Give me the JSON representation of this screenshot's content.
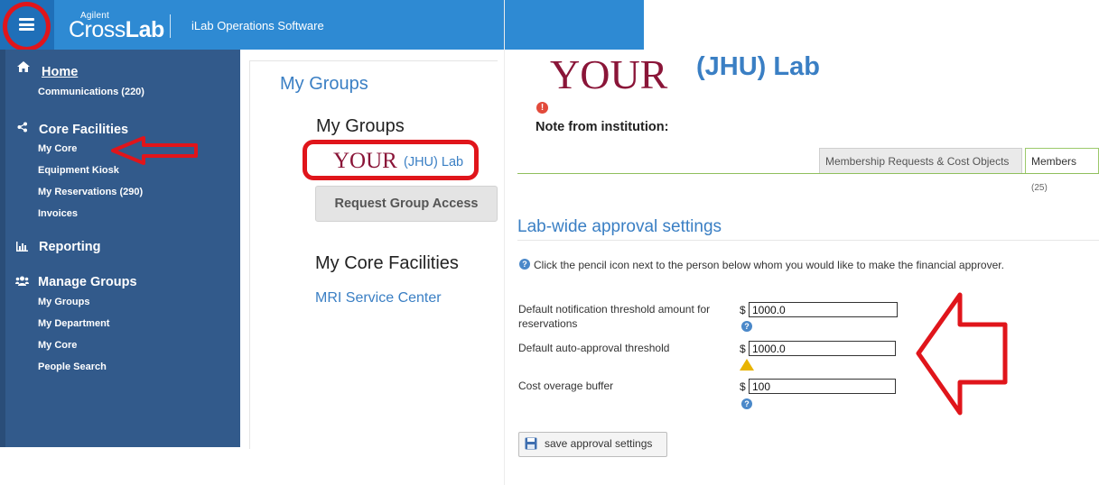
{
  "header": {
    "brand_small": "Agilent",
    "brand_light": "Cross",
    "brand_bold": "Lab",
    "app_name": "iLab Operations Software",
    "menu_icon": "hamburger-icon"
  },
  "sidebar": {
    "sections": [
      {
        "label": "Home",
        "icon": "home-icon",
        "items": [
          "Communications (220)"
        ]
      },
      {
        "label": "Core Facilities",
        "icon": "share-icon",
        "items": [
          "My Core",
          "Equipment Kiosk",
          "My Reservations (290)",
          "Invoices"
        ]
      },
      {
        "label": "Reporting",
        "icon": "bar-chart-icon",
        "items": []
      },
      {
        "label": "Manage Groups",
        "icon": "group-icon",
        "items": [
          "My Groups",
          "My Department",
          "My Core",
          "People Search"
        ]
      }
    ]
  },
  "middle": {
    "title": "My Groups",
    "groups_heading": "My Groups",
    "group_logo": "YOUR",
    "group_name": "(JHU) Lab",
    "request_button": "Request Group Access",
    "core_heading": "My Core Facilities",
    "core_link": "MRI Service Center"
  },
  "lab": {
    "logo": "YOUR",
    "name": "(JHU) Lab",
    "note_label": "Note from institution:"
  },
  "tabs": [
    {
      "label": "Membership Requests & Cost Objects"
    },
    {
      "label": "Members",
      "count": "(25)"
    }
  ],
  "approval": {
    "title": "Lab-wide approval settings",
    "instructions": "Click the pencil icon next to the person below whom you would like to make the financial approver.",
    "currency": "$",
    "fields": [
      {
        "label": "Default notification threshold amount for reservations",
        "value": "1000.0",
        "icon": "help-icon"
      },
      {
        "label": "Default auto-approval threshold",
        "value": "1000.0",
        "icon": "warning-icon"
      },
      {
        "label": "Cost overage buffer",
        "value": "100",
        "icon": "help-icon"
      }
    ],
    "save_button": "save approval settings"
  },
  "colors": {
    "header_blue": "#2e8ad3",
    "sidebar_blue": "#325a8b",
    "link_blue": "#3a7fc4",
    "logo_maroon": "#8a1538",
    "annotation_red": "#e0151b",
    "tab_green": "#8fbf5c"
  }
}
